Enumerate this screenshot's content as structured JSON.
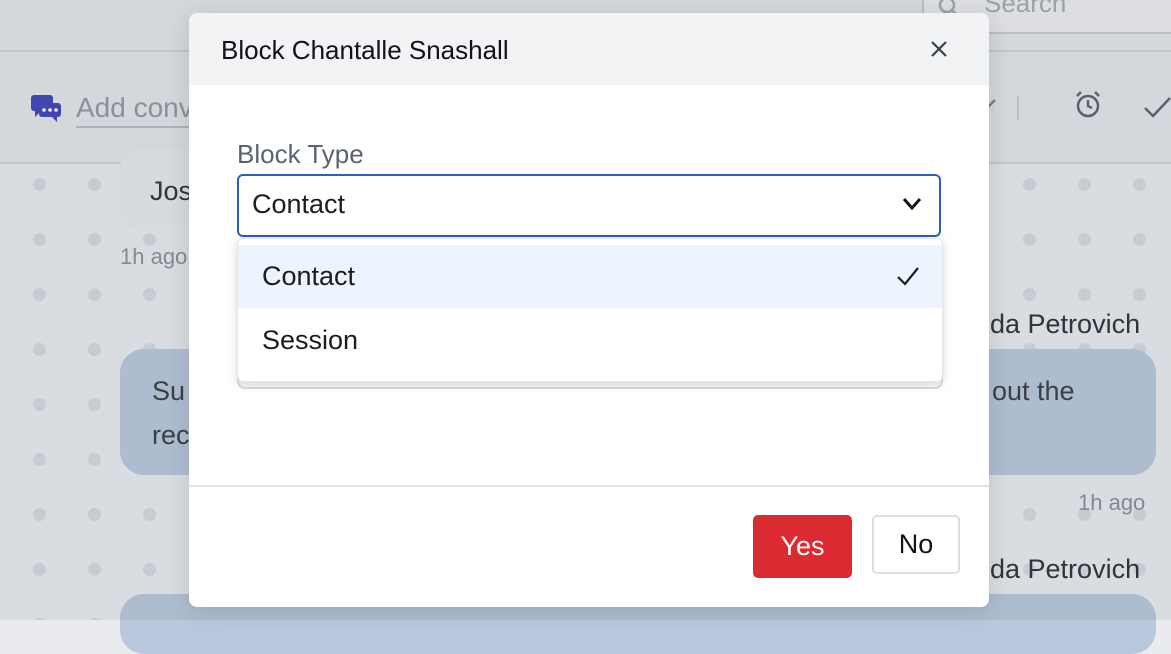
{
  "background": {
    "search_placeholder": "Search",
    "add_conversation_placeholder": "Add conversation",
    "messages": [
      {
        "sender_fragment": "Jos",
        "time": "1h ago"
      },
      {
        "sender": "Amanda Petrovich",
        "sender_fragment": "da Petrovich",
        "text_left": "Su",
        "text_left2": "rec",
        "text_right": "out the",
        "time": "1h ago"
      },
      {
        "sender": "Amanda Petrovich",
        "sender_fragment": "da Petrovich"
      }
    ]
  },
  "modal": {
    "title": "Block Chantalle Snashall",
    "field_label": "Block Type",
    "selected_value": "Contact",
    "options": [
      {
        "label": "Contact",
        "selected": true
      },
      {
        "label": "Session",
        "selected": false
      }
    ],
    "yes_label": "Yes",
    "no_label": "No"
  },
  "colors": {
    "accent": "#2b5fc6",
    "danger": "#dc2a32",
    "selected_row": "#eef4fd",
    "bubble": "#b9c8dd"
  },
  "icons": [
    "search-icon",
    "chat-icon",
    "alarm-icon",
    "check-icon",
    "close-icon",
    "chevron-down-icon",
    "checkmark-icon"
  ]
}
